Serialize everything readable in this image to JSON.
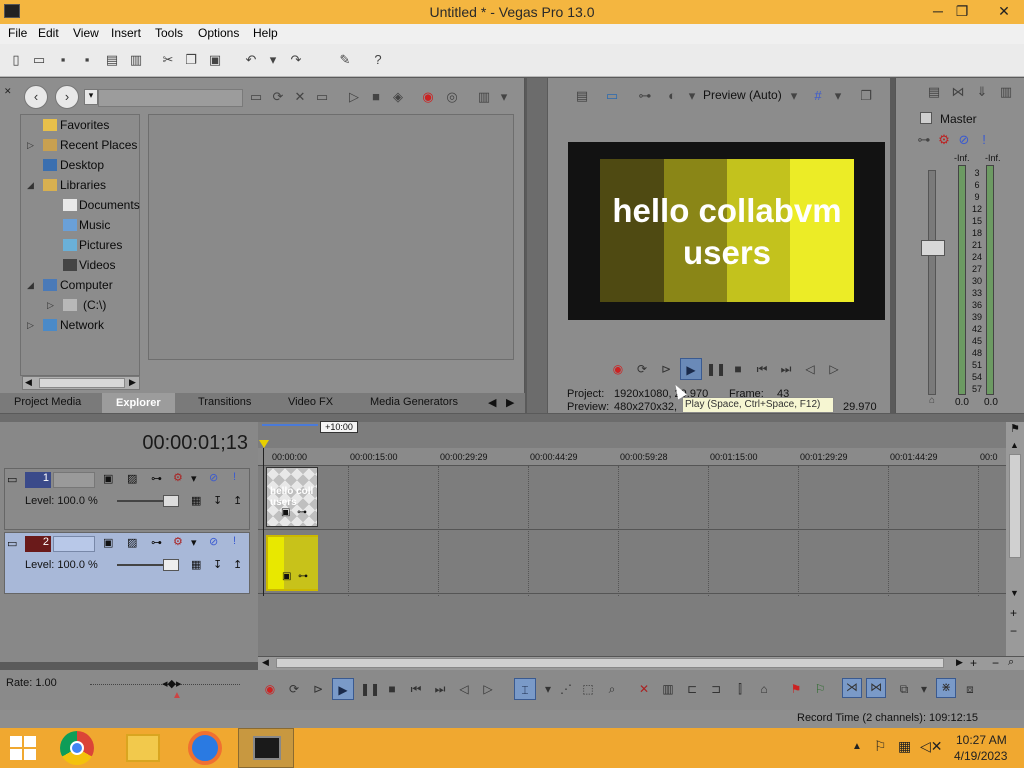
{
  "window": {
    "title": "Untitled * - Vegas Pro 13.0",
    "minimize": "─",
    "maximize": "❐",
    "close": "✕"
  },
  "menu": [
    "File",
    "Edit",
    "View",
    "Insert",
    "Tools",
    "Options",
    "Help"
  ],
  "explorer": {
    "tree": [
      {
        "label": "Favorites"
      },
      {
        "label": "Recent Places"
      },
      {
        "label": "Desktop"
      },
      {
        "label": "Libraries"
      },
      {
        "label": "Documents"
      },
      {
        "label": "Music"
      },
      {
        "label": "Pictures"
      },
      {
        "label": "Videos"
      },
      {
        "label": "Computer"
      },
      {
        "label": "(C:\\)"
      },
      {
        "label": "Network"
      }
    ],
    "tabs": [
      "Project Media",
      "Explorer",
      "Transitions",
      "Video FX",
      "Media Generators"
    ]
  },
  "preview": {
    "mode": "Preview (Auto)",
    "text": "hello collabvm users",
    "bar_colors": [
      "#4f4a12",
      "#8a8617",
      "#c3c21d",
      "#ecec26"
    ],
    "project_label": "Project:",
    "project_value": "1920x1080, 29.970",
    "frame_label": "Frame:",
    "frame_value": "43",
    "preview_label": "Preview:",
    "preview_value": "480x270x32,",
    "display_value": "29.970",
    "tooltip": "Play (Space, Ctrl+Space, F12)"
  },
  "master": {
    "label": "Master",
    "left_inf": "-Inf.",
    "right_inf": "-Inf.",
    "scale": [
      "3",
      "6",
      "9",
      "12",
      "15",
      "18",
      "21",
      "24",
      "27",
      "30",
      "33",
      "36",
      "39",
      "42",
      "45",
      "48",
      "51",
      "54",
      "57"
    ],
    "left_val": "0.0",
    "right_val": "0.0"
  },
  "timeline": {
    "time": "00:00:01;13",
    "offset": "+10:00",
    "ruler": [
      "00:00:00",
      "00:00:15:00",
      "00:00:29:29",
      "00:00:44:29",
      "00:00:59:28",
      "00:01:15:00",
      "00:01:29:29",
      "00:01:44:29",
      "00:0"
    ],
    "tracks": [
      {
        "number": "1",
        "level": "Level: 100.0 %"
      },
      {
        "number": "2",
        "level": "Level: 100.0 %"
      }
    ],
    "clip1_text": "hello coll users"
  },
  "bottom": {
    "rate": "Rate: 1.00",
    "record_time": "Record Time (2 channels): 109:12:15"
  },
  "clock": {
    "time": "10:27 AM",
    "date": "4/19/2023"
  }
}
